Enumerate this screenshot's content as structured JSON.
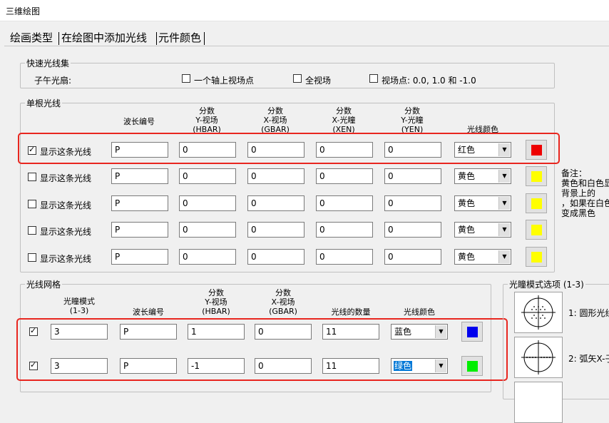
{
  "window": {
    "title": "三维绘图"
  },
  "tabs": [
    {
      "label": "绘画类型"
    },
    {
      "label": "在绘图中添加光线"
    },
    {
      "label": "元件颜色"
    }
  ],
  "quick_rays": {
    "legend": "快速光线集",
    "fan_label": "子午光扇:",
    "options": [
      {
        "label": "一个轴上视场点",
        "checked": false
      },
      {
        "label": "全视场",
        "checked": false
      },
      {
        "label": "视场点: 0.0, 1.0 和 -1.0",
        "checked": false
      }
    ]
  },
  "single_ray": {
    "legend": "单根光线",
    "headers": {
      "wave": "波长编号",
      "hbar": [
        "分数",
        "Y-视场",
        "(HBAR)"
      ],
      "gbar": [
        "分数",
        "X-视场",
        "(GBAR)"
      ],
      "xen": [
        "分数",
        "X-光瞳",
        "(XEN)"
      ],
      "yen": [
        "分数",
        "Y-光瞳",
        "(YEN)"
      ],
      "color": "光线颜色"
    },
    "show_label": "显示这条光线",
    "rows": [
      {
        "checked": true,
        "wave": "P",
        "hbar": "0",
        "gbar": "0",
        "xen": "0",
        "yen": "0",
        "color_name": "红色",
        "swatch": "#ee0000"
      },
      {
        "checked": false,
        "wave": "P",
        "hbar": "0",
        "gbar": "0",
        "xen": "0",
        "yen": "0",
        "color_name": "黄色",
        "swatch": "#ffff00"
      },
      {
        "checked": false,
        "wave": "P",
        "hbar": "0",
        "gbar": "0",
        "xen": "0",
        "yen": "0",
        "color_name": "黄色",
        "swatch": "#ffff00"
      },
      {
        "checked": false,
        "wave": "P",
        "hbar": "0",
        "gbar": "0",
        "xen": "0",
        "yen": "0",
        "color_name": "黄色",
        "swatch": "#ffff00"
      },
      {
        "checked": false,
        "wave": "P",
        "hbar": "0",
        "gbar": "0",
        "xen": "0",
        "yen": "0",
        "color_name": "黄色",
        "swatch": "#ffff00"
      }
    ]
  },
  "note": {
    "lines": [
      "备注：",
      "黄色和白色显",
      "背景上的",
      "，如果在白色",
      "变成黑色"
    ]
  },
  "ray_grid": {
    "legend": "光线网格",
    "headers": {
      "mode": [
        "光瞳模式",
        "(1-3)"
      ],
      "wave": "波长编号",
      "hbar": [
        "分数",
        "Y-视场",
        "(HBAR)"
      ],
      "gbar": [
        "分数",
        "X-视场",
        "(GBAR)"
      ],
      "count": "光线的数量",
      "color": "光线颜色"
    },
    "rows": [
      {
        "checked": true,
        "mode": "3",
        "wave": "P",
        "hbar": "1",
        "gbar": "0",
        "count": "11",
        "color_name": "蓝色",
        "swatch": "#0000ee",
        "highlight": false
      },
      {
        "checked": true,
        "mode": "3",
        "wave": "P",
        "hbar": "-1",
        "gbar": "0",
        "count": "11",
        "color_name": "绿色",
        "swatch": "#00ee00",
        "highlight": true
      }
    ]
  },
  "pupil_options": {
    "legend": "光瞳模式选项 (1-3)",
    "items": [
      {
        "label": "1: 圆形光线"
      },
      {
        "label": "2: 弧矢X-子"
      }
    ]
  },
  "colors": {
    "highlight_red": "#e8261f",
    "accent_blue": "#0078d7"
  }
}
